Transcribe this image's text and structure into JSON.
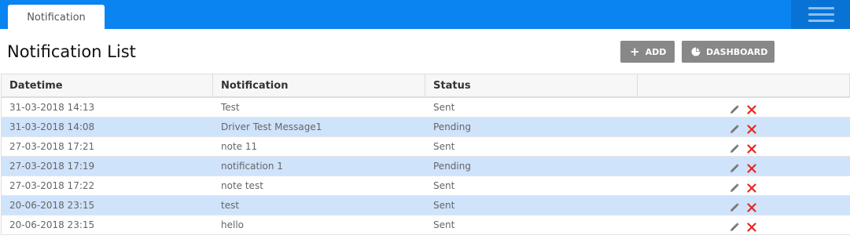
{
  "header": {
    "tab_label": "Notification",
    "menu_icon": "hamburger-menu-icon"
  },
  "page": {
    "title": "Notification List"
  },
  "toolbar": {
    "add_label": "ADD",
    "add_icon": "plus-icon",
    "dashboard_label": "DASHBOARD",
    "dashboard_icon": "pie-chart-icon"
  },
  "table": {
    "columns": [
      "Datetime",
      "Notification",
      "Status",
      ""
    ],
    "rows": [
      {
        "datetime": "31-03-2018 14:13",
        "notification": "Test",
        "status": "Sent"
      },
      {
        "datetime": "31-03-2018 14:08",
        "notification": "Driver Test Message1",
        "status": "Pending"
      },
      {
        "datetime": "27-03-2018 17:21",
        "notification": "note 11",
        "status": "Sent"
      },
      {
        "datetime": "27-03-2018 17:19",
        "notification": "notification 1",
        "status": "Pending"
      },
      {
        "datetime": "27-03-2018 17:22",
        "notification": "note test",
        "status": "Sent"
      },
      {
        "datetime": "20-06-2018 23:15",
        "notification": "test",
        "status": "Sent"
      },
      {
        "datetime": "20-06-2018 23:15",
        "notification": "hello",
        "status": "Sent"
      }
    ],
    "row_actions": [
      "edit-icon",
      "delete-icon"
    ]
  },
  "colors": {
    "topbar": "#0a84f0",
    "stripe": "#cfe3fb",
    "button": "#888888",
    "delete": "#e8271c"
  }
}
